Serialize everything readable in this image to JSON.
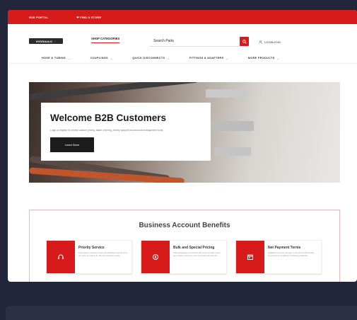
{
  "topbar": {
    "link1": "B2B PORTAL",
    "link2": "❤ FIND A STORE"
  },
  "header": {
    "logo_text": "HYDRAULIC",
    "logo_accent": "X",
    "tab_label": "SHOP CATEGORIES",
    "search_placeholder": "Search Parts",
    "account_label": "LOGIN/JOIN"
  },
  "nav": {
    "items": [
      {
        "label": "HOSE & TUBING"
      },
      {
        "label": "COUPLINGS"
      },
      {
        "label": "QUICK DISCONNECTS"
      },
      {
        "label": "FITTINGS & ADAPTERS"
      },
      {
        "label": "MORE PRODUCTS"
      }
    ]
  },
  "hero": {
    "title": "Welcome B2B Customers",
    "subtitle": "Login or register to receive custom pricing, faster ordering, priority support and account management tools.",
    "button": "Learn More"
  },
  "benefits": {
    "heading": "Business Account Benefits",
    "items": [
      {
        "title": "Priority Service",
        "desc": "Enjoy faster response times and dedicated support from our team of experts for all your business needs.",
        "icon": "headset-icon"
      },
      {
        "title": "Bulk and Special Pricing",
        "desc": "Take advantage of exclusive discounts on bulk orders and custom pricing on your most ordered products.",
        "icon": "tag-icon"
      },
      {
        "title": "Net Payment Terms",
        "desc": "Qualified accounts can pay on net terms with flexible invoicing and simplified purchasing workflows.",
        "icon": "calendar-icon"
      }
    ]
  },
  "colors": {
    "accent": "#d71a1a",
    "dark": "#1c1c1c",
    "background": "#22263a"
  }
}
